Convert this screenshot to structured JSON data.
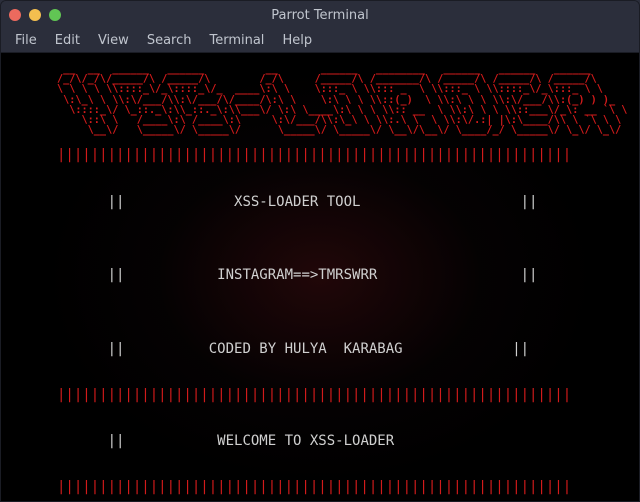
{
  "window": {
    "title": "Parrot Terminal"
  },
  "menu": {
    "items": [
      "File",
      "Edit",
      "View",
      "Search",
      "Terminal",
      "Help"
    ]
  },
  "ascii_logo": " __  __  ______   ______          __       ______   ________   ______   ______   ______    \n/_/\\/_/\\/_____/\\ /_____/\\        /_/\\     /_____/\\ /_______/\\ /_____/\\ /_____/\\ /_____/\\   \n\\ \\ \\ \\ \\\\::::_\\/_\\::::_\\/_  ____\\:\\ \\    \\:::_ \\ \\\\::: _  \\ \\\\:::_ \\ \\\\::::_\\/_\\:::_ \\ \\  \n \\:\\_\\ \\ \\\\:\\/___/\\\\:\\/___/\\/____/\\:\\ \\    \\:\\ \\ \\ \\\\::(_)  \\ \\\\:\\ \\ \\ \\\\:\\/___/\\\\:(_) ) )_\n  \\::::_\\/ \\_::._\\:\\\\_::._\\:\\\\___\\/ \\:\\ \\____\\:\\ \\ \\ \\\\:: __  \\ \\\\:\\ \\ \\ \\\\::___\\/_\\: __ `\\ \\\n    \\::\\ \\   /____\\:\\ /____\\:\\     \\:\\/___/\\\\:\\_\\ \\ \\\\:.\\ \\  \\ \\\\:\\/.:| |\\:\\____/\\\\ \\ `\\ \\ \\\n     \\__\\/   \\_____\\/ \\_____\\/      \\_____\\/ \\_____\\/ \\__\\/\\__\\/ \\____/_/ \\_____\\/ \\_\\/ \\_\\/",
  "divider": "|||||||||||||||||||||||||||||||||||||||||||||||||||||||||||||",
  "info_lines": [
    {
      "left": "||",
      "center": "XSS-LOADER TOOL",
      "right": "||"
    },
    {
      "left": "||",
      "center": "INSTAGRAM==>TMRSWRR",
      "right": "||"
    },
    {
      "left": "||",
      "center": "CODED BY HULYA  KARABAG",
      "right": "||"
    }
  ],
  "welcome_line": {
    "left": "||",
    "center": "WELCOME TO XSS-LOADER",
    "right": ""
  }
}
